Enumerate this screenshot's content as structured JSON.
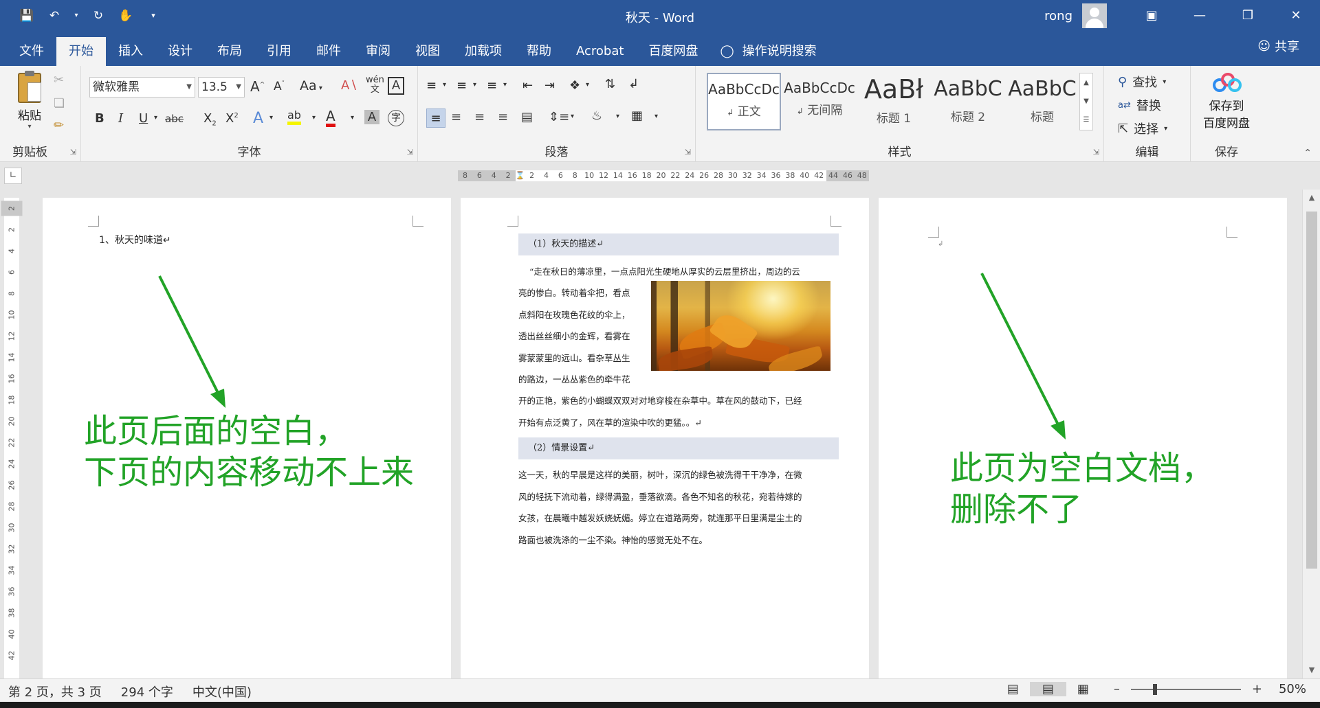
{
  "window": {
    "title": "秋天 - Word",
    "user": "rong"
  },
  "tabs": [
    "文件",
    "开始",
    "插入",
    "设计",
    "布局",
    "引用",
    "邮件",
    "审阅",
    "视图",
    "加载项",
    "帮助",
    "Acrobat",
    "百度网盘"
  ],
  "active_tab": "开始",
  "search_label": "操作说明搜索",
  "share_label": "共享",
  "ribbon": {
    "clipboard": {
      "label": "剪贴板",
      "paste": "粘贴"
    },
    "font": {
      "label": "字体",
      "name": "微软雅黑",
      "size": "13.5",
      "change_case": "Aa"
    },
    "paragraph": {
      "label": "段落"
    },
    "styles": {
      "label": "样式",
      "items": [
        {
          "sample": "AaBbCcDc",
          "name": "正文"
        },
        {
          "sample": "AaBbCcDc",
          "name": "无间隔"
        },
        {
          "sample": "AaBł",
          "name": "标题 1"
        },
        {
          "sample": "AaBbC",
          "name": "标题 2"
        },
        {
          "sample": "AaBbC",
          "name": "标题"
        }
      ]
    },
    "editing": {
      "label": "编辑",
      "find": "查找",
      "replace": "替换",
      "select": "选择"
    },
    "save": {
      "label": "保存",
      "button_line1": "保存到",
      "button_line2": "百度网盘"
    }
  },
  "ruler": {
    "left_margin_ticks": [
      "8",
      "6",
      "4",
      "2"
    ],
    "text_ticks": [
      "2",
      "4",
      "6",
      "8",
      "10",
      "12",
      "14",
      "16",
      "18",
      "20",
      "22",
      "24",
      "26",
      "28",
      "30",
      "32",
      "34",
      "36",
      "38",
      "40",
      "42"
    ],
    "right_margin_ticks": [
      "44",
      "46",
      "48"
    ],
    "vertical_ticks": [
      "2",
      "2",
      "4",
      "6",
      "8",
      "10",
      "12",
      "14",
      "16",
      "18",
      "20",
      "22",
      "24",
      "26",
      "28",
      "30",
      "32",
      "34",
      "36",
      "38",
      "40",
      "42"
    ]
  },
  "page1": {
    "line": "1、秋天的味道↵",
    "annotation_line1": "此页后面的空白，",
    "annotation_line2": "下页的内容移动不上来"
  },
  "page2": {
    "heading1": "（1）秋天的描述↵",
    "para1_line1": "“走在秋日的薄凉里，一点点阳光生硬地从厚实的云层里挤出，周边的云",
    "para1_wrapped": [
      "亮的惨白。转动着伞把，看点",
      "点斜阳在玫瑰色花纹的伞上，",
      "透出丝丝细小的金辉，看雾在",
      "雾蒙蒙里的远山。看杂草丛生",
      "的路边，一丛丛紫色的牵牛花"
    ],
    "para1_tail": [
      "开的正艳，紫色的小蝴蝶双双对对地穿梭在杂草中。草在风的鼓动下，已经",
      "开始有点泛黄了，风在草的渲染中吹的更猛。。↵"
    ],
    "heading2": "（2）情景设置↵",
    "para2": [
      "这一天，秋的早晨是这样的美丽，树叶，深沉的绿色被洗得干干净净，在微",
      "风的轻抚下流动着，绿得满盈，垂落欲滴。各色不知名的秋花，宛若待嫁的",
      "女孩，在晨曦中越发妖娆妩媚。婷立在道路两旁，就连那平日里满是尘土的",
      "路面也被洗涤的一尘不染。神怡的感觉无处不在。"
    ]
  },
  "page3": {
    "annotation_line1": "此页为空白文档，",
    "annotation_line2": "删除不了"
  },
  "statusbar": {
    "page": "第 2 页，共 3 页",
    "words": "294 个字",
    "language": "中文(中国)",
    "zoom": "50%"
  },
  "colors": {
    "word_blue": "#2b579a",
    "annotation_green": "#22a327",
    "heading_shade": "#dfe3ed"
  }
}
